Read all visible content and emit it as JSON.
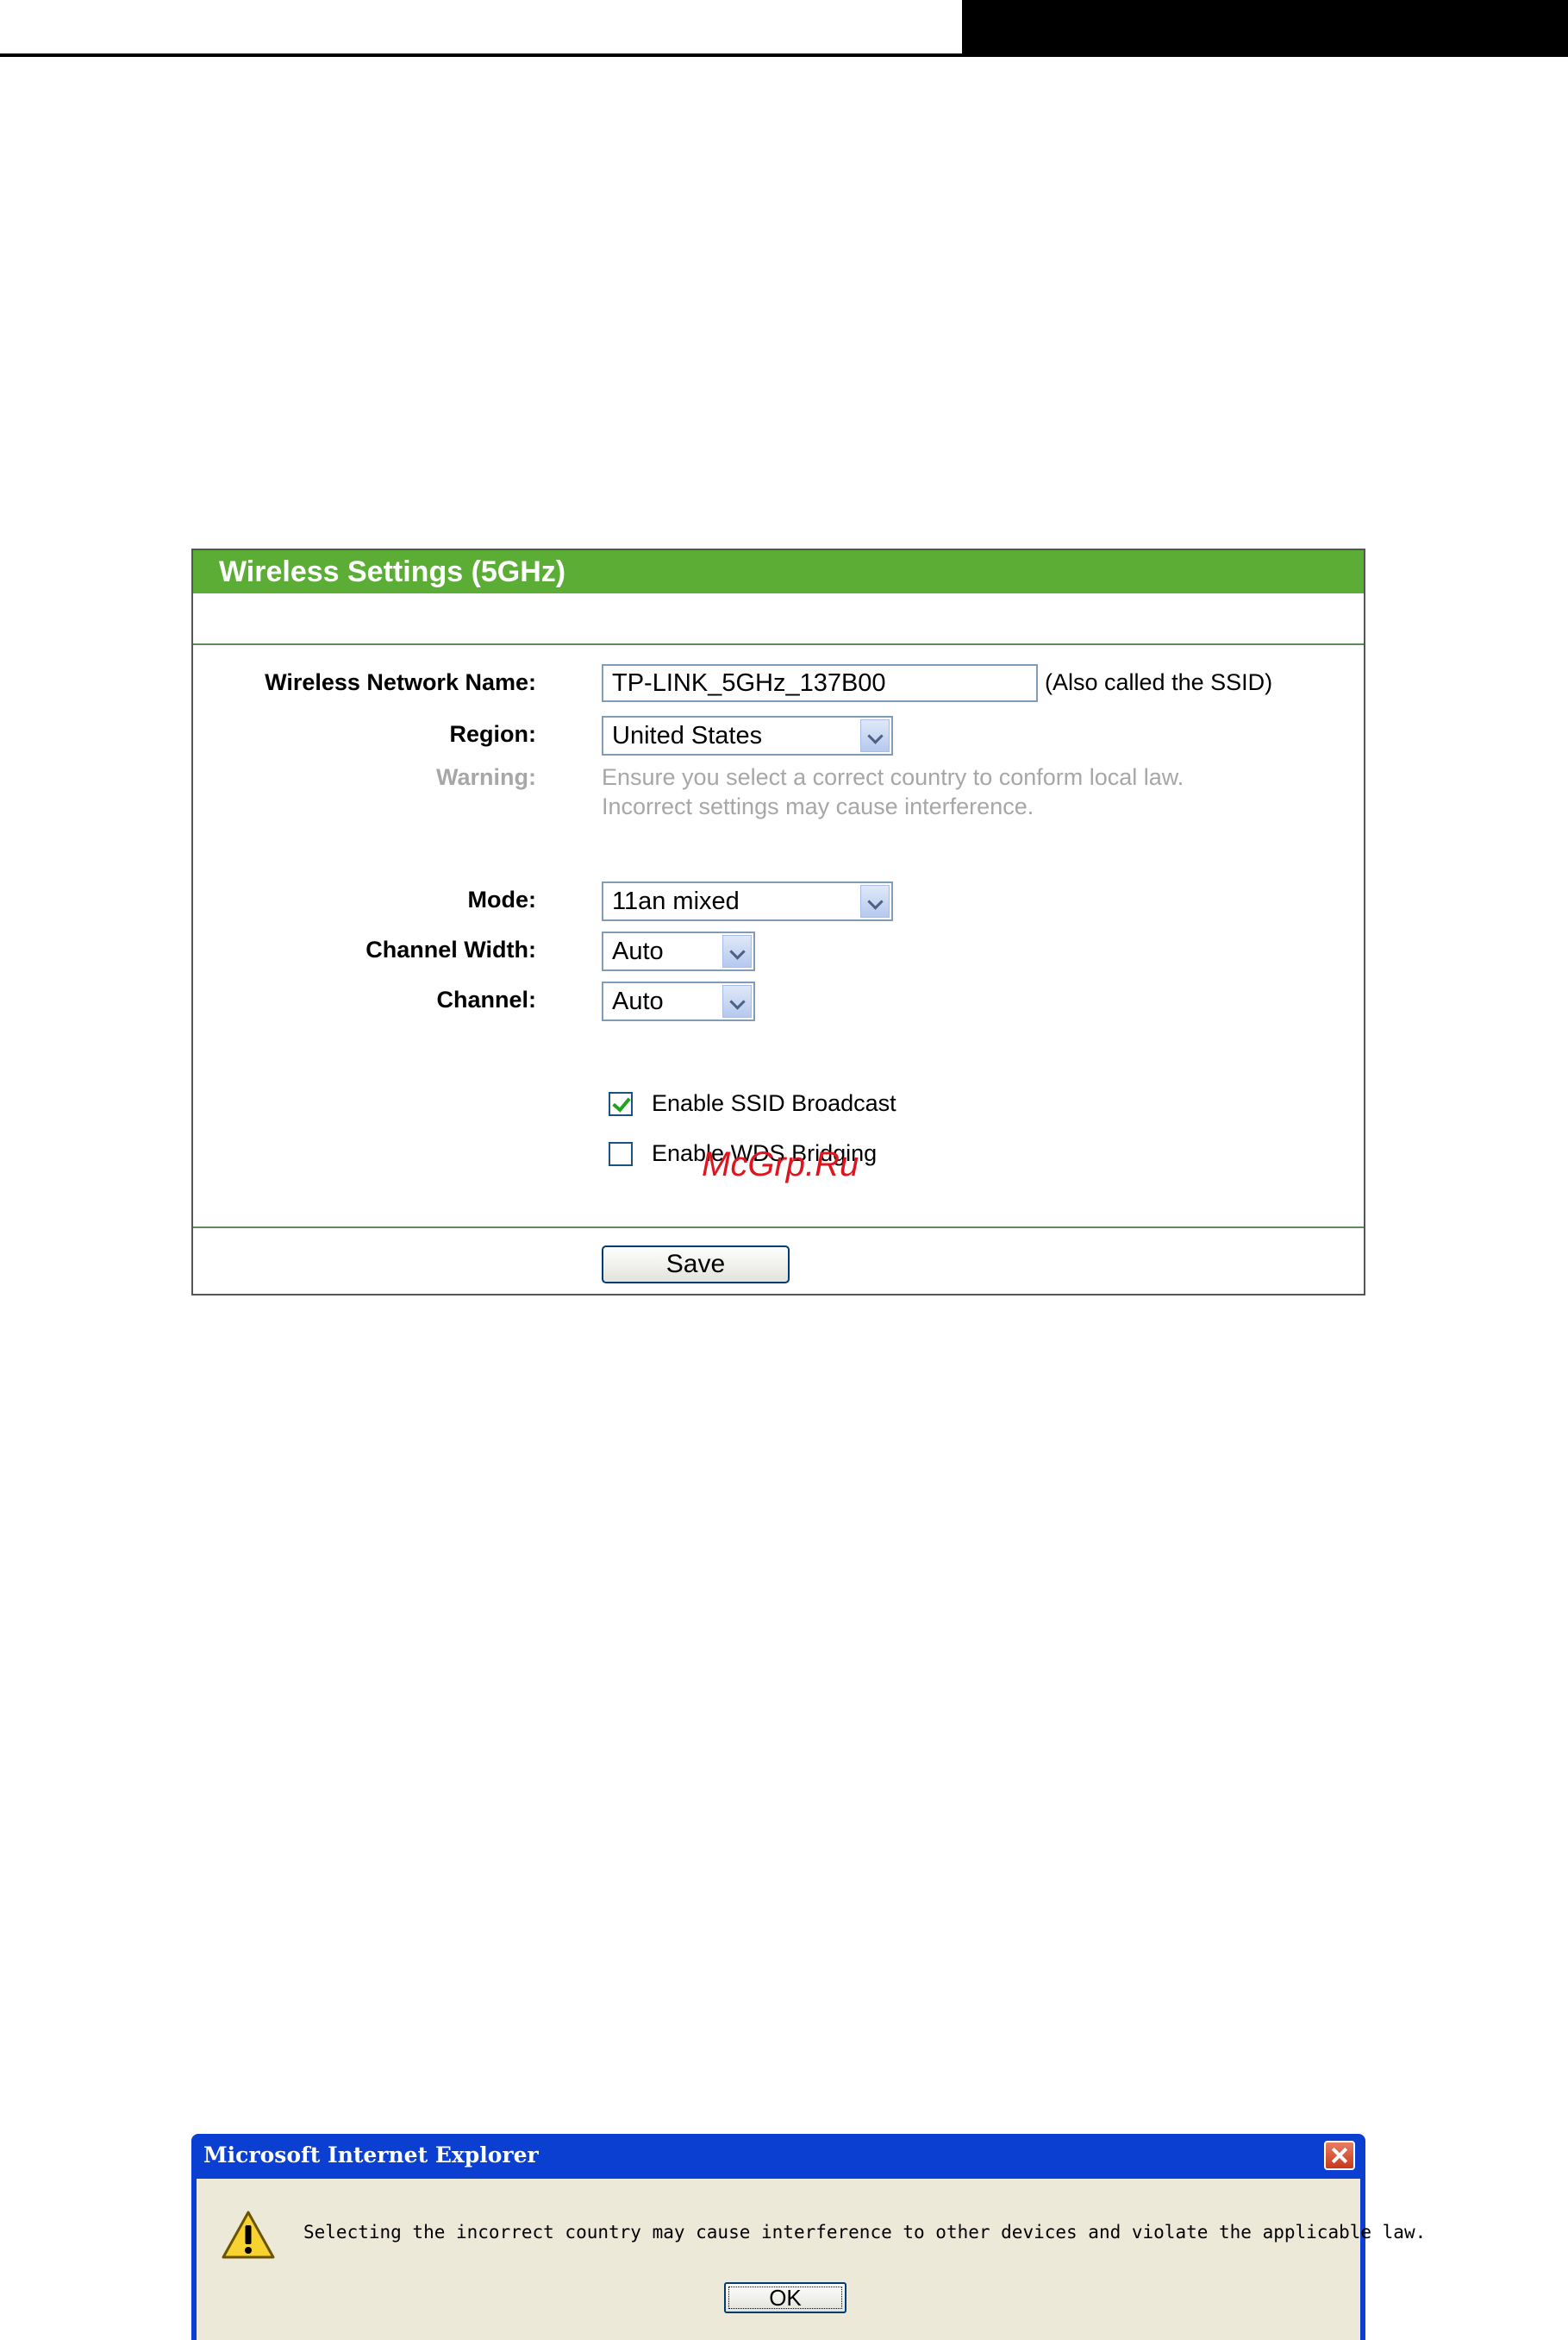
{
  "panel": {
    "title": "Wireless Settings (5GHz)",
    "network_name_label": "Wireless Network Name:",
    "network_name_value": "TP-LINK_5GHz_137B00",
    "ssid_hint": "(Also called the SSID)",
    "region_label": "Region:",
    "region_value": "United States",
    "warning_label": "Warning:",
    "warning_line1": "Ensure you select a correct country to conform local law.",
    "warning_line2": "Incorrect settings may cause interference.",
    "mode_label": "Mode:",
    "mode_value": "11an mixed",
    "channel_width_label": "Channel Width:",
    "channel_width_value": "Auto",
    "channel_label": "Channel:",
    "channel_value": "Auto",
    "ssid_broadcast_label": "Enable SSID Broadcast",
    "ssid_broadcast_checked": true,
    "wds_label": "Enable WDS Bridging",
    "wds_checked": false,
    "save_label": "Save"
  },
  "watermark": "McGrp.Ru",
  "dialog": {
    "title": "Microsoft Internet Explorer",
    "message": "Selecting the incorrect country may cause interference to other devices and violate the applicable law.",
    "ok_label": "OK",
    "icon": "warning-icon"
  },
  "colors": {
    "title_bar": "#5bad35",
    "separator": "#5d8d56",
    "muted_text": "#a7a7a7",
    "dialog_title_bar": "#0a3fd2",
    "dialog_body": "#ece9d8",
    "watermark": "#e0141e"
  }
}
